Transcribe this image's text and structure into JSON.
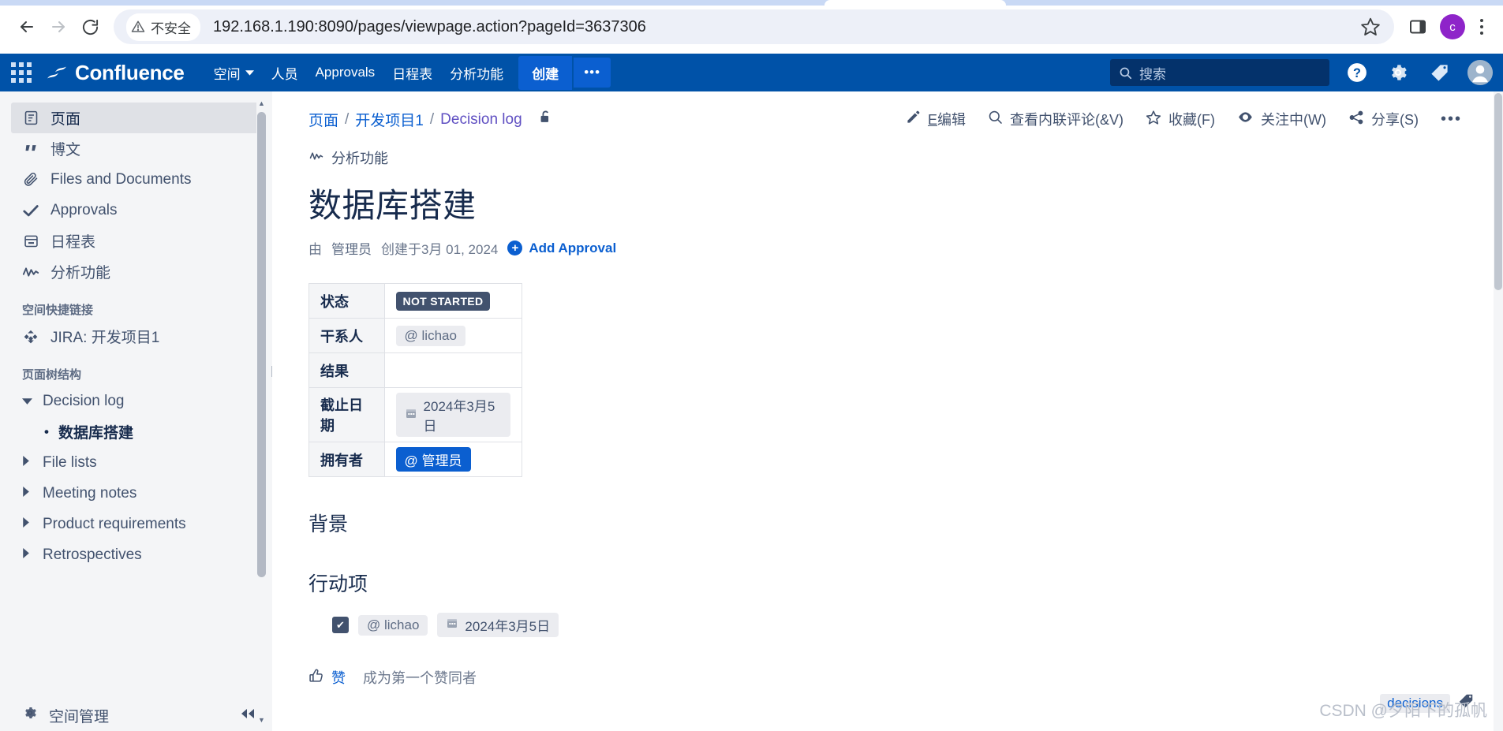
{
  "browser": {
    "back_label": "back",
    "forward_label": "forward",
    "reload_label": "reload",
    "security_text": "不安全",
    "url": "192.168.1.190:8090/pages/viewpage.action?pageId=3637306",
    "profile_initial": "c"
  },
  "topnav": {
    "brand": "Confluence",
    "links": [
      {
        "label": "空间",
        "has_chevron": true
      },
      {
        "label": "人员",
        "has_chevron": false
      },
      {
        "label": "Approvals",
        "has_chevron": false
      },
      {
        "label": "日程表",
        "has_chevron": false
      },
      {
        "label": "分析功能",
        "has_chevron": false
      }
    ],
    "create_label": "创建",
    "create_more_label": "•••",
    "search_placeholder": "搜索"
  },
  "sidebar": {
    "items": [
      {
        "label": "页面",
        "icon": "page-icon",
        "active": true
      },
      {
        "label": "博文",
        "icon": "quote-icon",
        "active": false
      },
      {
        "label": "Files and Documents",
        "icon": "paperclip-icon",
        "active": false
      },
      {
        "label": "Approvals",
        "icon": "check-icon",
        "active": false
      },
      {
        "label": "日程表",
        "icon": "calendar-icon",
        "active": false
      },
      {
        "label": "分析功能",
        "icon": "analytics-icon",
        "active": false
      }
    ],
    "shortcuts_header": "空间快捷链接",
    "shortcut_item": "JIRA: 开发项目1",
    "tree_header": "页面树结构",
    "tree": [
      {
        "label": "Decision log",
        "expanded": true
      },
      {
        "label": "File lists",
        "expanded": false
      },
      {
        "label": "Meeting notes",
        "expanded": false
      },
      {
        "label": "Product requirements",
        "expanded": false
      },
      {
        "label": "Retrospectives",
        "expanded": false
      }
    ],
    "tree_child": "数据库搭建",
    "footer_label": "空间管理"
  },
  "page": {
    "breadcrumb": [
      {
        "label": "页面",
        "visited": false
      },
      {
        "label": "开发项目1",
        "visited": false
      },
      {
        "label": "Decision log",
        "visited": true
      }
    ],
    "breadcrumb_sep": "/",
    "actions": [
      {
        "label": "编辑",
        "accel": "E",
        "accel_pos": "before",
        "icon": "pencil-icon"
      },
      {
        "label": "查看内联评论(&V)",
        "accel": "",
        "icon": "comment-search-icon"
      },
      {
        "label": "收藏(F)",
        "accel": "F",
        "icon": "star-icon"
      },
      {
        "label": "关注中(W)",
        "accel": "W",
        "icon": "eye-icon"
      },
      {
        "label": "分享(S)",
        "accel": "S",
        "icon": "share-icon"
      }
    ],
    "more_actions": "•••",
    "blueprint_label": "分析功能",
    "title": "数据库搭建",
    "byline_prefix": "由",
    "byline_author": "管理员",
    "byline_text": "创建于3月 01, 2024",
    "add_approval": "Add Approval",
    "table": [
      {
        "key": "状态",
        "value": "NOT STARTED",
        "style": "badge-dark"
      },
      {
        "key": "干系人",
        "value": "@ lichao",
        "style": "pill-grey"
      },
      {
        "key": "结果",
        "value": "",
        "style": "empty"
      },
      {
        "key": "截止日期",
        "value": "2024年3月5日",
        "style": "pill-date"
      },
      {
        "key": "拥有者",
        "value": "@ 管理员",
        "style": "pill-blue"
      }
    ],
    "section_background": "背景",
    "section_actions": "行动项",
    "task": {
      "checked": true,
      "assignee": "@ lichao",
      "due": "2024年3月5日"
    },
    "like_label": "赞",
    "like_hint": "成为第一个赞同者",
    "label_chip": "decisions",
    "watermark": "CSDN @夕阳下的孤帆"
  },
  "colors": {
    "nav_blue": "#0052a8",
    "create_blue": "#0b5fd0",
    "link_blue": "#0b5fd0",
    "sidebar_bg": "#f4f5f7",
    "status_dark": "#42526e",
    "profile_purple": "#8e24c9"
  }
}
